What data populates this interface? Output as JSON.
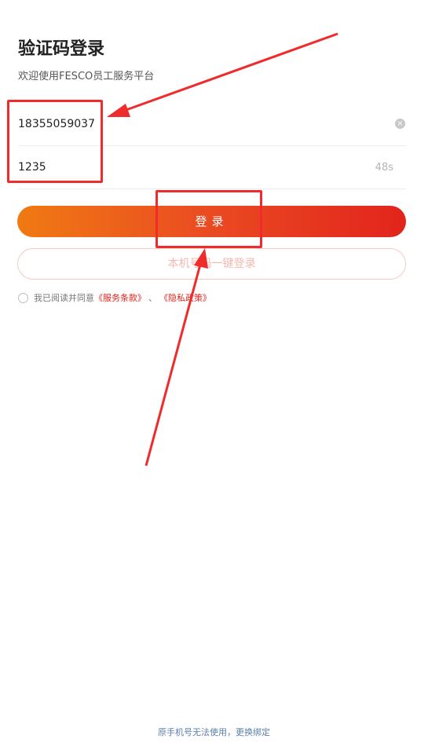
{
  "header": {
    "title": "验证码登录",
    "subtitle": "欢迎使用FESCO员工服务平台"
  },
  "form": {
    "phone_value": "18355059037",
    "code_value": "1235",
    "countdown": "48s"
  },
  "buttons": {
    "login_label": "登录",
    "onekey_label": "本机号码一键登录"
  },
  "agreement": {
    "prefix": "我已阅读并同意",
    "terms": "《服务条款》",
    "separator": "、",
    "privacy": "《隐私政策》"
  },
  "footer": {
    "link": "原手机号无法使用，更换绑定"
  },
  "colors": {
    "accent_start": "#f07a13",
    "accent_end": "#e2241c",
    "annotation": "#ef2b2b"
  },
  "icons": {
    "clear": "clear-icon",
    "checkbox": "checkbox-icon",
    "arrow": "arrow-icon"
  }
}
